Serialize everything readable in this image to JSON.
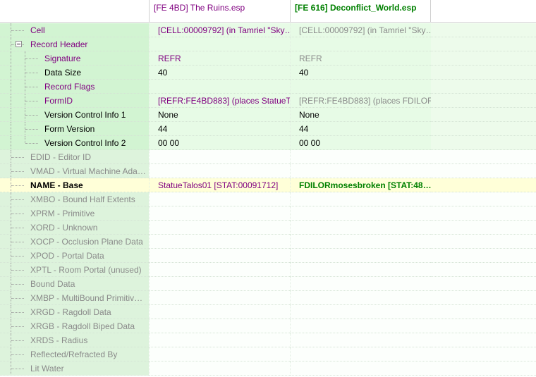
{
  "columns": {
    "label": "",
    "file1": "[FE 4BD] The Ruins.esp",
    "file2": "[FE 616] Deconflict_World.esp",
    "file3": ""
  },
  "colors": {
    "conflict_green": "#d2f4d2",
    "conflict_winner_bg": "#ffffd8",
    "purple_text": "#800080",
    "override_text": "#008000",
    "inactive_text": "#8a8a8a"
  },
  "rows": [
    {
      "label": "Cell",
      "v1": "[CELL:00009792] (in Tamriel \"Sky…",
      "v2": "[CELL:00009792] (in Tamriel \"Sky…"
    },
    {
      "label": "Record Header",
      "v1": "",
      "v2": ""
    },
    {
      "label": "Signature",
      "v1": "REFR",
      "v2": "REFR"
    },
    {
      "label": "Data Size",
      "v1": "40",
      "v2": "40"
    },
    {
      "label": "Record Flags",
      "v1": "",
      "v2": ""
    },
    {
      "label": "FormID",
      "v1": "[REFR:FE4BD883] (places StatueT…",
      "v2": "[REFR:FE4BD883] (places FDILOR…"
    },
    {
      "label": "Version Control Info 1",
      "v1": "None",
      "v2": "None"
    },
    {
      "label": "Form Version",
      "v1": "44",
      "v2": "44"
    },
    {
      "label": "Version Control Info 2",
      "v1": "00 00",
      "v2": "00 00"
    },
    {
      "label": "EDID - Editor ID",
      "v1": "",
      "v2": ""
    },
    {
      "label": "VMAD - Virtual Machine Ada…",
      "v1": "",
      "v2": ""
    },
    {
      "label": "NAME - Base",
      "v1": "StatueTalos01 [STAT:00091712]",
      "v2": "FDILORmosesbroken [STAT:48…"
    },
    {
      "label": "XMBO - Bound Half Extents",
      "v1": "",
      "v2": ""
    },
    {
      "label": "XPRM - Primitive",
      "v1": "",
      "v2": ""
    },
    {
      "label": "XORD - Unknown",
      "v1": "",
      "v2": ""
    },
    {
      "label": "XOCP - Occlusion Plane Data",
      "v1": "",
      "v2": ""
    },
    {
      "label": "XPOD - Portal Data",
      "v1": "",
      "v2": ""
    },
    {
      "label": "XPTL - Room Portal (unused)",
      "v1": "",
      "v2": ""
    },
    {
      "label": "Bound Data",
      "v1": "",
      "v2": ""
    },
    {
      "label": "XMBP - MultiBound Primitiv…",
      "v1": "",
      "v2": ""
    },
    {
      "label": "XRGD - Ragdoll Data",
      "v1": "",
      "v2": ""
    },
    {
      "label": "XRGB - Ragdoll Biped Data",
      "v1": "",
      "v2": ""
    },
    {
      "label": "XRDS - Radius",
      "v1": "",
      "v2": ""
    },
    {
      "label": "Reflected/Refracted By",
      "v1": "",
      "v2": ""
    },
    {
      "label": "Lit Water",
      "v1": "",
      "v2": ""
    }
  ]
}
